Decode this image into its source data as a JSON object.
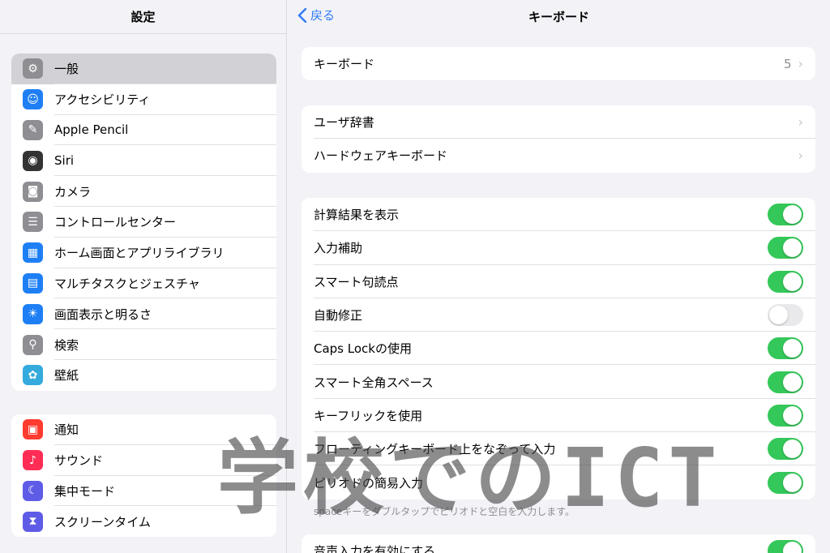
{
  "sidebar": {
    "title": "設定",
    "group1": [
      {
        "label": "一般",
        "icon": "gear-icon",
        "color": "#8e8e93",
        "glyph": "⚙",
        "selected": true
      },
      {
        "label": "アクセシビリティ",
        "icon": "accessibility-icon",
        "color": "#1e7ff5",
        "glyph": "☺"
      },
      {
        "label": "Apple Pencil",
        "icon": "pencil-icon",
        "color": "#8e8e93",
        "glyph": "✎"
      },
      {
        "label": "Siri",
        "icon": "siri-icon",
        "color": "#333333",
        "glyph": "◉"
      },
      {
        "label": "カメラ",
        "icon": "camera-icon",
        "color": "#8e8e93",
        "glyph": "◙"
      },
      {
        "label": "コントロールセンター",
        "icon": "control-center-icon",
        "color": "#8e8e93",
        "glyph": "☰"
      },
      {
        "label": "ホーム画面とアプリライブラリ",
        "icon": "home-screen-icon",
        "color": "#1e7ff5",
        "glyph": "▦"
      },
      {
        "label": "マルチタスクとジェスチャ",
        "icon": "multitasking-icon",
        "color": "#1e7ff5",
        "glyph": "▤"
      },
      {
        "label": "画面表示と明るさ",
        "icon": "brightness-icon",
        "color": "#1e7ff5",
        "glyph": "☀"
      },
      {
        "label": "検索",
        "icon": "search-icon",
        "color": "#8e8e93",
        "glyph": "⚲"
      },
      {
        "label": "壁紙",
        "icon": "wallpaper-icon",
        "color": "#35aadc",
        "glyph": "✿"
      }
    ],
    "group2": [
      {
        "label": "通知",
        "icon": "notifications-icon",
        "color": "#ff3b30",
        "glyph": "▣"
      },
      {
        "label": "サウンド",
        "icon": "sound-icon",
        "color": "#ff2d55",
        "glyph": "♪"
      },
      {
        "label": "集中モード",
        "icon": "focus-moon-icon",
        "color": "#5e5ce6",
        "glyph": "☾"
      },
      {
        "label": "スクリーンタイム",
        "icon": "screen-time-icon",
        "color": "#5e5ce6",
        "glyph": "⧗"
      }
    ]
  },
  "header": {
    "back_label": "戻る",
    "title": "キーボード"
  },
  "card1": [
    {
      "label": "キーボード",
      "value": "5"
    }
  ],
  "card2": [
    {
      "label": "ユーザ辞書"
    },
    {
      "label": "ハードウェアキーボード"
    }
  ],
  "card3": [
    {
      "label": "計算結果を表示",
      "on": true
    },
    {
      "label": "入力補助",
      "on": true
    },
    {
      "label": "スマート句読点",
      "on": true
    },
    {
      "label": "自動修正",
      "on": false
    },
    {
      "label": "Caps Lockの使用",
      "on": true
    },
    {
      "label": "スマート全角スペース",
      "on": true
    },
    {
      "label": "キーフリックを使用",
      "on": true
    },
    {
      "label": "フローティングキーボード上をなぞって入力",
      "on": true
    },
    {
      "label": "ピリオドの簡易入力",
      "on": true
    }
  ],
  "footnote": "spaceキーをダブルタップでピリオドと空白を入力します。",
  "card4": [
    {
      "label": "音声入力を有効にする",
      "on": true
    }
  ],
  "watermark": "学校でのICT",
  "colors": {
    "accent": "#2f7cf6",
    "toggle_on": "#34c759",
    "toggle_off": "#e9e9eb"
  }
}
